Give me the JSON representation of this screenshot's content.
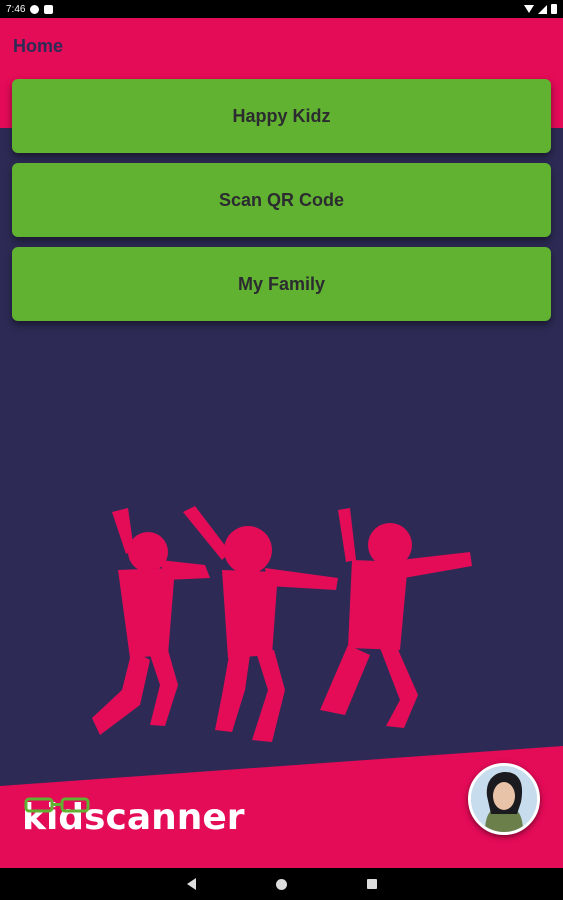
{
  "status_bar": {
    "time": "7:46"
  },
  "header": {
    "title": "Home"
  },
  "menu": {
    "items": [
      {
        "label": "Happy Kidz"
      },
      {
        "label": "Scan QR Code"
      },
      {
        "label": "My Family"
      }
    ]
  },
  "brand": {
    "logo_text": "kidscanner"
  },
  "colors": {
    "primary": "#e40b57",
    "background": "#2d2b55",
    "button": "#61b231",
    "button_text": "#2b2b30"
  }
}
